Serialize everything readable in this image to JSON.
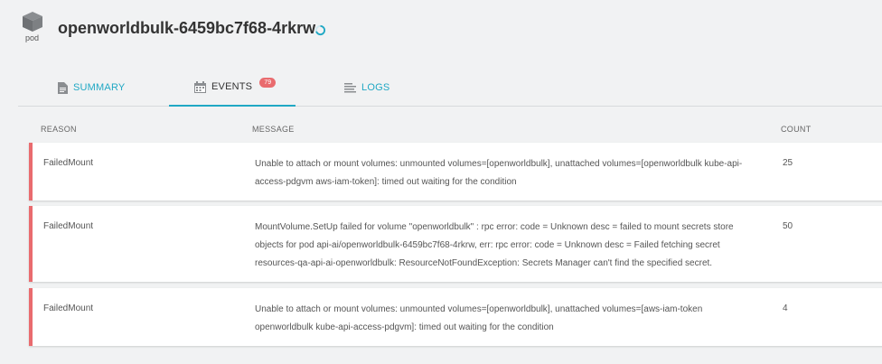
{
  "header": {
    "pod_icon": "cube-icon",
    "pod_label": "pod",
    "title": "openworldbulk-6459bc7f68-4rkrw",
    "status_icon": "loading-spinner-icon"
  },
  "tabs": [
    {
      "label": "SUMMARY",
      "icon": "document-icon",
      "active": false
    },
    {
      "label": "EVENTS",
      "icon": "calendar-icon",
      "active": true,
      "badge": "79"
    },
    {
      "label": "LOGS",
      "icon": "lines-icon",
      "active": false
    }
  ],
  "table": {
    "columns": [
      "REASON",
      "MESSAGE",
      "COUNT"
    ],
    "rows": [
      {
        "reason": "FailedMount",
        "message": "Unable to attach or mount volumes: unmounted volumes=[openworldbulk], unattached volumes=[openworldbulk kube-api-access-pdgvm aws-iam-token]: timed out waiting for the condition",
        "count": "25"
      },
      {
        "reason": "FailedMount",
        "message": "MountVolume.SetUp failed for volume \"openworldbulk\" : rpc error: code = Unknown desc = failed to mount secrets store objects for pod api-ai/openworldbulk-6459bc7f68-4rkrw, err: rpc error: code = Unknown desc = Failed fetching secret resources-qa-api-ai-openworldbulk: ResourceNotFoundException: Secrets Manager can't find the specified secret.",
        "count": "50"
      },
      {
        "reason": "FailedMount",
        "message": "Unable to attach or mount volumes: unmounted volumes=[openworldbulk], unattached volumes=[aws-iam-token openworldbulk kube-api-access-pdgvm]: timed out waiting for the condition",
        "count": "4"
      }
    ]
  },
  "colors": {
    "accent": "#20a8c4",
    "error": "#e96b6e",
    "badge": "#e96b6e"
  }
}
